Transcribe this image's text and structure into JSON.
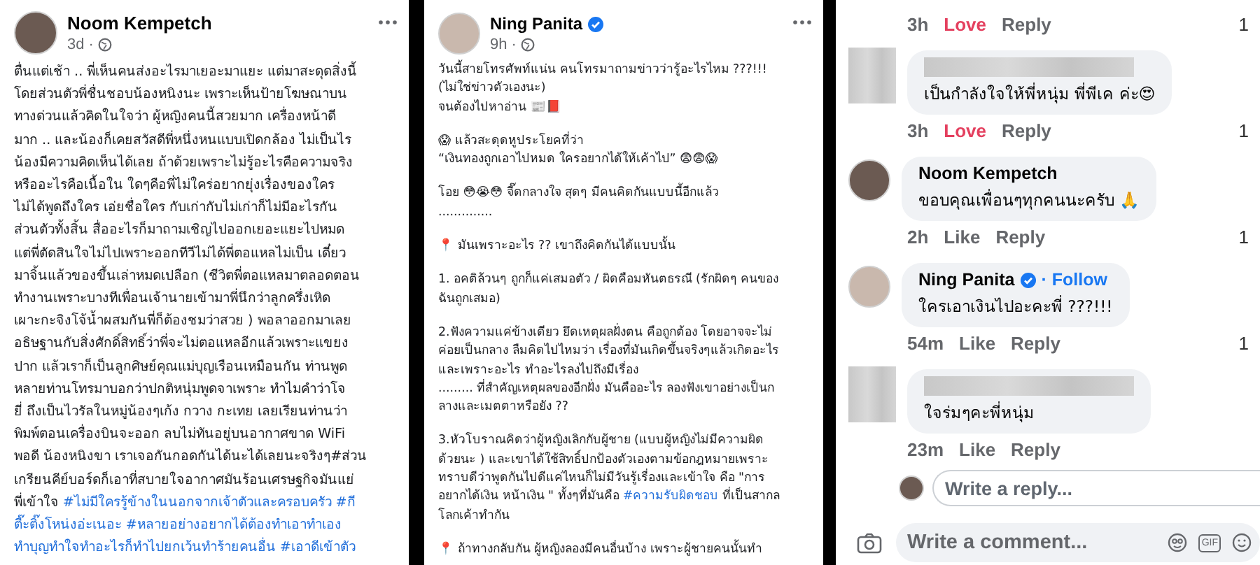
{
  "posts": [
    {
      "author": "Noom Kempetch",
      "verified": false,
      "time": "3d",
      "separator": "·",
      "lines": [
        {
          "kind": "text",
          "parts": [
            {
              "kind": "text",
              "text": "ตื่นแต่เช้า .. พี่เห็นคนส่งอะไรมาเยอะมาแยะ แต่มาสะดุดสิ่งนี้"
            }
          ]
        },
        {
          "kind": "text",
          "parts": [
            {
              "kind": "text",
              "text": "โดยส่วนตัวพี่ชื่นชอบน้องหนิงนะ เพราะเห็นป้ายโฆษณาบน"
            }
          ]
        },
        {
          "kind": "text",
          "parts": [
            {
              "kind": "text",
              "text": "ทางด่วนแล้วคิดในใจว่า ผู้หญิงคนนี้สวยมาก เครื่องหน้าดี"
            }
          ]
        },
        {
          "kind": "text",
          "parts": [
            {
              "kind": "text",
              "text": "มาก .. และน้องก็เคยสวัสดีพี่หนึ่งหนแบบเปิดกล้อง ไม่เป็นไร"
            }
          ]
        },
        {
          "kind": "text",
          "parts": [
            {
              "kind": "text",
              "text": "น้องมีความคิดเห็นได้เลย ถ้าด้วยเพราะไม่รู้อะไรคือความจริง"
            }
          ]
        },
        {
          "kind": "text",
          "parts": [
            {
              "kind": "text",
              "text": "หรืออะไรคือเนื้อใน   ใดๆคือพี่ไม่ใคร่อยากยุ่งเรื่องของใคร"
            }
          ]
        },
        {
          "kind": "text",
          "parts": [
            {
              "kind": "text",
              "text": "ไม่ได้พูดถึงใคร เอ่ยชื่อใคร กับเก่ากับไม่เก่าก็ไม่มีอะไรกัน"
            }
          ]
        },
        {
          "kind": "text",
          "parts": [
            {
              "kind": "text",
              "text": "ส่วนตัวทั้งสิ้น  สื่ออะไรก็มาถามเชิญไปออกเยอะแยะไปหมด"
            }
          ]
        },
        {
          "kind": "text",
          "parts": [
            {
              "kind": "text",
              "text": "แต่พี่ตัดสินใจไม่ไปเพราะออกทีวีไม่ได้พี่ตอแหลไม่เป็น เดี๋ยว"
            }
          ]
        },
        {
          "kind": "text",
          "parts": [
            {
              "kind": "text",
              "text": "มาจิ้นแล้วของขึ้นเล่าหมดเปลือก (ชีวิตพี่ตอแหลมาตลอดตอน"
            }
          ]
        },
        {
          "kind": "text",
          "parts": [
            {
              "kind": "text",
              "text": "ทำงานเพราะบางทีเพื่อนเจ้านายเข้ามาพี่นึกว่าลูกครึ่งเหิด"
            }
          ]
        },
        {
          "kind": "text",
          "parts": [
            {
              "kind": "text",
              "text": "เผาะกะจิงโจ้น้ำผสมกันพี่ก็ต้องชมว่าสวย ) พอลาออกมาเลย"
            }
          ]
        },
        {
          "kind": "text",
          "parts": [
            {
              "kind": "text",
              "text": "อธิษฐานกับสิ่งศักดิ์สิทธิ์ว่าพี่จะไม่ตอแหลอีกแล้วเพราะแขยง"
            }
          ]
        },
        {
          "kind": "text",
          "parts": [
            {
              "kind": "text",
              "text": "ปาก แล้วเราก็เป็นลูกศิษย์คุณแม่บุญเรือนเหมือนกัน ท่านพูด"
            }
          ]
        },
        {
          "kind": "text",
          "parts": [
            {
              "kind": "text",
              "text": "หลายท่านโทรมาบอกว่าปกติหนุ่มพูดจาเพราะ ทำไมคำว่าโจ"
            }
          ]
        },
        {
          "kind": "text",
          "parts": [
            {
              "kind": "text",
              "text": "ยี่ ถึงเป็นไวรัลในหมู่น้องๆเก้ง กวาง กะเทย เลยเรียนท่านว่า"
            }
          ]
        },
        {
          "kind": "text",
          "parts": [
            {
              "kind": "text",
              "text": "พิมพ์ตอนเครื่องบินจะออก ลบไม่ทันอยู่บนอากาศขาด WiFi"
            }
          ]
        },
        {
          "kind": "text",
          "parts": [
            {
              "kind": "text",
              "text": "พอดี น้องหนิงขา เราเจอกันกอดกันได้นะได้เลยนะจริงๆ#ส่วน"
            }
          ]
        },
        {
          "kind": "text",
          "parts": [
            {
              "kind": "text",
              "text": "เกรียนคีย์บอร์ดก็เอาที่สบายใจอากาศมันร้อนเศรษฐกิจมันแย่"
            }
          ]
        },
        {
          "kind": "text",
          "parts": [
            {
              "kind": "text",
              "text": "พี่เข้าใจ"
            },
            {
              "kind": "hashtag",
              "text": "#ไม่มีใครรู้ข้างในนอกจากเจ้าตัวและครอบครัว"
            },
            {
              "kind": "hashtag",
              "text": "#กี"
            }
          ]
        },
        {
          "kind": "text",
          "parts": [
            {
              "kind": "hashtag",
              "text": "ตี๊ะติ๊งโหน่งอ่ะเนอะ"
            },
            {
              "kind": "hashtag",
              "text": "#หลายอย่างอยากได้ต้องทำเอาทำเอง"
            }
          ]
        },
        {
          "kind": "text",
          "parts": [
            {
              "kind": "hashtag",
              "text": "ทำบุญทำใจทำอะไรก็ทำไปยกเว้นทำร้ายคนอื่น"
            },
            {
              "kind": "hashtag",
              "text": "#เอาดีเข้าตัว"
            }
          ]
        }
      ]
    },
    {
      "author": "Ning Panita",
      "verified": true,
      "time": "9h",
      "separator": "·",
      "lines": [
        {
          "kind": "text",
          "parts": [
            {
              "kind": "text",
              "text": "วันนี้สายโทรศัพท์แน่น คนโทรมาถามข่าวว่ารู้อะไรไหม ???!!!"
            }
          ]
        },
        {
          "kind": "text",
          "parts": [
            {
              "kind": "text",
              "text": "(ไม่ใช่ข่าวตัวเองนะ)"
            }
          ]
        },
        {
          "kind": "text",
          "parts": [
            {
              "kind": "text",
              "text": "จนต้องไปหาอ่าน 📰📕"
            }
          ]
        },
        {
          "kind": "gap"
        },
        {
          "kind": "text",
          "parts": [
            {
              "kind": "text",
              "text": "😱 แล้วสะดุดหูประโยคที่ว่า"
            }
          ]
        },
        {
          "kind": "text",
          "parts": [
            {
              "kind": "text",
              "text": "“เงินทองถูกเอาไปหมด ใครอยากได้ให้เค้าไป” 😨😨😱"
            }
          ]
        },
        {
          "kind": "gap"
        },
        {
          "kind": "text",
          "parts": [
            {
              "kind": "text",
              "text": "โอย 😳😭😳 จี๊ดกลางใจ สุดๆ มีคนคิดกันแบบนี้อีกแล้ว"
            }
          ]
        },
        {
          "kind": "text",
          "parts": [
            {
              "kind": "text",
              "text": ".............."
            }
          ]
        },
        {
          "kind": "gap"
        },
        {
          "kind": "text",
          "parts": [
            {
              "kind": "text",
              "text": "📍 มันเพราะอะไร ?? เขาถึงคิดกันได้แบบนั้น"
            }
          ]
        },
        {
          "kind": "gap"
        },
        {
          "kind": "text",
          "parts": [
            {
              "kind": "text",
              "text": "1. อคติล้วนๆ ถูกก็แค่เสมอตัว / ผิดคือมหันตธรณี (รักผิดๆ คนของ"
            }
          ]
        },
        {
          "kind": "text",
          "parts": [
            {
              "kind": "text",
              "text": "ฉันถูกเสมอ)"
            }
          ]
        },
        {
          "kind": "gap"
        },
        {
          "kind": "text",
          "parts": [
            {
              "kind": "text",
              "text": "2.ฟังความแค่ข้างเดียว ยึดเหตุผลฝั่งตน คือถูกต้อง โดยอาจจะไม่"
            }
          ]
        },
        {
          "kind": "text",
          "parts": [
            {
              "kind": "text",
              "text": "ค่อยเป็นกลาง ลืมคิดไปไหมว่า เรื่องที่มันเกิดขึ้นจริงๆแล้วเกิดอะไร"
            }
          ]
        },
        {
          "kind": "text",
          "parts": [
            {
              "kind": "text",
              "text": "และเพราะอะไร ทำอะไรลงไปถึงมีเรื่อง"
            }
          ]
        },
        {
          "kind": "text",
          "parts": [
            {
              "kind": "text",
              "text": "......... ที่สำคัญเหตุผลของอีกฝั่ง มันคืออะไร ลองฟังเขาอย่างเป็นก"
            }
          ]
        },
        {
          "kind": "text",
          "parts": [
            {
              "kind": "text",
              "text": "ลางและเมตตาหรือยัง ??"
            }
          ]
        },
        {
          "kind": "gap"
        },
        {
          "kind": "text",
          "parts": [
            {
              "kind": "text",
              "text": "3.หัวโบราณคิดว่าผู้หญิงเลิกกับผู้ชาย  (แบบผู้หญิงไม่มีความผิด"
            }
          ]
        },
        {
          "kind": "text",
          "parts": [
            {
              "kind": "text",
              "text": "ด้วยนะ ) และเขาได้ใช้สิทธิ์ปกป้องตัวเองตามข้อกฎหมายเพราะ"
            }
          ]
        },
        {
          "kind": "text",
          "parts": [
            {
              "kind": "text",
              "text": "ทราบดีว่าพูดกันไปดีแค่ไหนก็ไม่มีวันรู้เรื่องและเข้าใจ คือ \"การ"
            }
          ]
        },
        {
          "kind": "text",
          "parts": [
            {
              "kind": "text",
              "text": "อยากได้เงิน หน้าเงิน \"  ทั้งๆที่มันคือ"
            },
            {
              "kind": "hashtag",
              "text": "#ความรับผิดชอบ"
            },
            {
              "kind": "text",
              "text": "ที่เป็นสากล"
            }
          ]
        },
        {
          "kind": "text",
          "parts": [
            {
              "kind": "text",
              "text": "โลกเค้าทำกัน"
            }
          ]
        },
        {
          "kind": "gap"
        },
        {
          "kind": "text",
          "parts": [
            {
              "kind": "text",
              "text": "📍 ถ้าทางกลับกัน ผู้หญิงลองมีคนอื่นบ้าง  เพราะผู้ชายคนนั้นทำ"
            }
          ]
        }
      ]
    }
  ],
  "comments": {
    "items": [
      {
        "kind": "meta",
        "time": "3h",
        "action": "Love",
        "reacted": true,
        "reply": "Reply",
        "count": "1"
      },
      {
        "kind": "comment",
        "redacted": true,
        "text": "เป็นกำลังใจให้พี่หนุ่ม พี่พีเค ค่ะ😍",
        "time": "3h",
        "action": "Love",
        "reacted": true,
        "reply": "Reply",
        "count": "1"
      },
      {
        "kind": "comment",
        "redacted": false,
        "author": "Noom Kempetch",
        "verified": false,
        "text": "ขอบคุณเพื่อนๆทุกคนนะครับ 🙏",
        "time": "2h",
        "action": "Like",
        "reacted": false,
        "reply": "Reply",
        "count": "1"
      },
      {
        "kind": "comment",
        "redacted": false,
        "author": "Ning Panita",
        "verified": true,
        "follow": "· Follow",
        "text": "ใครเอาเงินไปอะคะพี่ ???!!!",
        "time": "54m",
        "action": "Like",
        "reacted": false,
        "reply": "Reply",
        "count": "1"
      },
      {
        "kind": "comment",
        "redacted": true,
        "text": "ใจร่มๆคะพี่หนุ่ม",
        "time": "23m",
        "action": "Like",
        "reacted": false,
        "reply": "Reply"
      }
    ],
    "reply_placeholder": "Write a reply...",
    "comment_placeholder": "Write a comment...",
    "gif_label": "GIF"
  }
}
